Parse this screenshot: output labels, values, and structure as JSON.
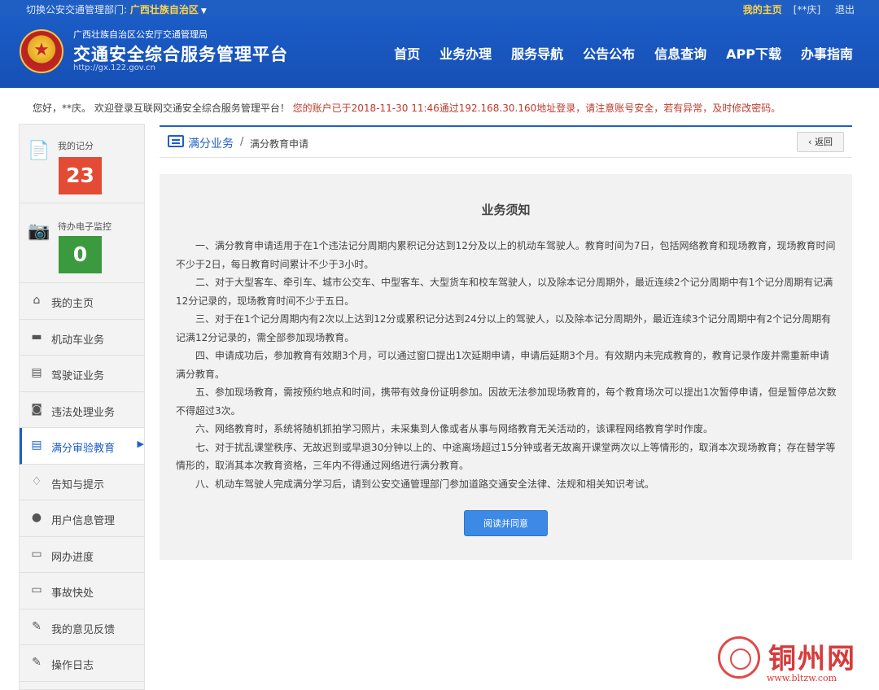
{
  "topbar": {
    "region_label": "切换公安交通管理部门: ",
    "region_value": "广西壮族自治区",
    "my_home": "我的主页",
    "user_mask": "[**庆]",
    "logout": "退出"
  },
  "header": {
    "dept": "广西壮族自治区公安厅交通管理局",
    "platform": "交通安全综合服务管理平台",
    "url": "http://gx.122.gov.cn",
    "nav": [
      "首页",
      "业务办理",
      "服务导航",
      "公告公布",
      "信息查询",
      "APP下载",
      "办事指南"
    ]
  },
  "welcome": {
    "greeting": "您好，**庆。 欢迎登录互联网交通安全综合服务管理平台！",
    "warning": "您的账户已于2018-11-30 11:46通过192.168.30.160地址登录，请注意账号安全，若有异常，及时修改密码。"
  },
  "sidebar": {
    "score_label": "我的记分",
    "score_value": "23",
    "monitor_label": "待办电子监控",
    "monitor_value": "0",
    "items": [
      {
        "label": "我的主页",
        "icon": "home-icon",
        "glyph": "⌂"
      },
      {
        "label": "机动车业务",
        "icon": "truck-icon",
        "glyph": "🚚"
      },
      {
        "label": "驾驶证业务",
        "icon": "license-card-icon",
        "glyph": "▤"
      },
      {
        "label": "违法处理业务",
        "icon": "camera-icon",
        "glyph": "◙"
      },
      {
        "label": "满分审验教育",
        "icon": "list-card-icon",
        "glyph": "▤"
      },
      {
        "label": "告知与提示",
        "icon": "bell-icon",
        "glyph": "♫"
      },
      {
        "label": "用户信息管理",
        "icon": "user-icon",
        "glyph": "●"
      },
      {
        "label": "网办进度",
        "icon": "progress-card-icon",
        "glyph": "▭"
      },
      {
        "label": "事故快处",
        "icon": "accident-card-icon",
        "glyph": "▭"
      },
      {
        "label": "我的意见反馈",
        "icon": "feedback-icon",
        "glyph": "✎"
      },
      {
        "label": "操作日志",
        "icon": "log-icon",
        "glyph": "✎"
      }
    ]
  },
  "breadcrumb": {
    "section": "满分业务",
    "separator": "/",
    "page": "满分教育申请",
    "back": "返回"
  },
  "notice": {
    "title": "业务须知",
    "paragraphs": [
      "一、满分教育申请适用于在1个违法记分周期内累积记分达到12分及以上的机动车驾驶人。教育时间为7日，包括网络教育和现场教育，现场教育时间不少于2日，每日教育时间累计不少于3小时。",
      "二、对于大型客车、牵引车、城市公交车、中型客车、大型货车和校车驾驶人，以及除本记分周期外，最近连续2个记分周期中有1个记分周期有记满12分记录的，现场教育时间不少于五日。",
      "三、对于在1个记分周期内有2次以上达到12分或累积记分达到24分以上的驾驶人，以及除本记分周期外，最近连续3个记分周期中有2个记分周期有记满12分记录的，需全部参加现场教育。",
      "四、申请成功后，参加教育有效期3个月，可以通过窗口提出1次延期申请，申请后延期3个月。有效期内未完成教育的，教育记录作废并需重新申请满分教育。",
      "五、参加现场教育，需按预约地点和时间，携带有效身份证明参加。因故无法参加现场教育的，每个教育场次可以提出1次暂停申请，但是暂停总次数不得超过3次。",
      "六、网络教育时，系统将随机抓拍学习照片，未采集到人像或者从事与网络教育无关活动的，该课程网络教育学时作废。",
      "七、对于扰乱课堂秩序、无故迟到或早退30分钟以上的、中途离场超过15分钟或者无故离开课堂两次以上等情形的，取消本次现场教育；存在替学等情形的，取消其本次教育资格，三年内不得通过网络进行满分教育。",
      "八、机动车驾驶人完成满分学习后，请到公安交通管理部门参加道路交通安全法律、法规和相关知识考试。"
    ],
    "agree_button": "阅读并同意"
  },
  "watermark": {
    "name": "铜州网",
    "url": "www.bltzw.com"
  }
}
